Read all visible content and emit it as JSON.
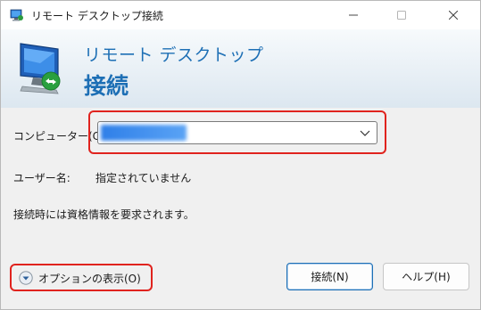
{
  "window": {
    "title": "リモート デスクトップ接続",
    "icon": "remote-desktop-icon",
    "controls": [
      "minimize-icon",
      "maximize-icon",
      "close-icon"
    ]
  },
  "banner": {
    "line1": "リモート デスクトップ",
    "line2": "接続",
    "icon": "monitor-connection-icon"
  },
  "form": {
    "computer_label": "コンピューター(C):",
    "computer_value": "",
    "user_label": "ユーザー名:",
    "user_value": "指定されていません",
    "info_text": "接続時には資格情報を要求されます。"
  },
  "footer": {
    "options_label": "オプションの表示(O)",
    "connect_label": "接続(N)",
    "help_label": "ヘルプ(H)"
  },
  "colors": {
    "accent": "#1d6fb5",
    "highlight": "#e0231e",
    "selection": "#2f7fe8"
  }
}
